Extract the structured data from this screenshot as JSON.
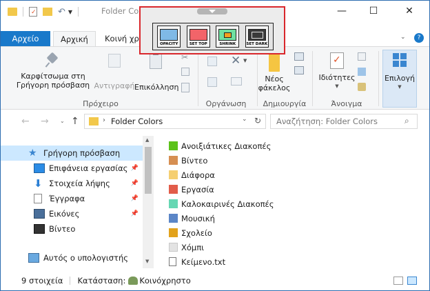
{
  "window": {
    "title": "Folder Colors",
    "controls": {
      "minimize": "—",
      "maximize": "☐",
      "close": "✕"
    }
  },
  "float_toolbar": {
    "buttons": [
      {
        "label": "OPACITY",
        "color": "#7fb9e6"
      },
      {
        "label": "SET TOP",
        "color": "#f26469"
      },
      {
        "label": "SHRINK",
        "color": "#f2a01e"
      },
      {
        "label": "SET DARK",
        "color": "#3a3a3a"
      }
    ]
  },
  "ribbon": {
    "tabs": {
      "file": "Αρχείο",
      "home": "Αρχική",
      "share": "Κοινή χρήση"
    },
    "pin": "Καρφίτσωμα στη Γρήγορη πρόσβαση",
    "copy": "Αντιγραφή",
    "paste": "Επικόλληση",
    "new_folder": "Νέος φάκελος",
    "properties": "Ιδιότητες",
    "select": "Επιλογή",
    "groups": {
      "clipboard": "Πρόχειρο",
      "organize": "Οργάνωση",
      "new": "Δημιουργία",
      "open": "Άνοιγμα"
    }
  },
  "address": {
    "path": "Folder Colors",
    "search_placeholder": "Αναζήτηση: Folder Colors"
  },
  "nav": {
    "items": [
      {
        "label": "Γρήγορη πρόσβαση",
        "icon": "star-icon"
      },
      {
        "label": "Επιφάνεια εργασίας",
        "icon": "desktop-icon"
      },
      {
        "label": "Στοιχεία λήψης",
        "icon": "download-icon"
      },
      {
        "label": "Έγγραφα",
        "icon": "document-icon"
      },
      {
        "label": "Εικόνες",
        "icon": "pictures-icon"
      },
      {
        "label": "Βίντεο",
        "icon": "video-icon"
      },
      {
        "label": "Αυτός ο υπολογιστής",
        "icon": "computer-icon"
      }
    ]
  },
  "files": [
    {
      "name": "Ανοιξιάτικες Διακοπές",
      "color": "#5cc21a"
    },
    {
      "name": "Βίντεο",
      "color": "#d68f52"
    },
    {
      "name": "Διάφορα",
      "color": "#f5cf72"
    },
    {
      "name": "Εργασία",
      "color": "#e25c4a"
    },
    {
      "name": "Καλοκαιρινές Διακοπές",
      "color": "#66d7b3"
    },
    {
      "name": "Μουσική",
      "color": "#5b86c7"
    },
    {
      "name": "Σχολείο",
      "color": "#e2a21c"
    },
    {
      "name": "Χόμπι",
      "color": "#e3e3e3"
    },
    {
      "name": "Κείμενο.txt",
      "color": ""
    }
  ],
  "status": {
    "count": "9 στοιχεία",
    "state_label": "Κατάσταση:",
    "state_value": "Κοινόχρηστο"
  }
}
